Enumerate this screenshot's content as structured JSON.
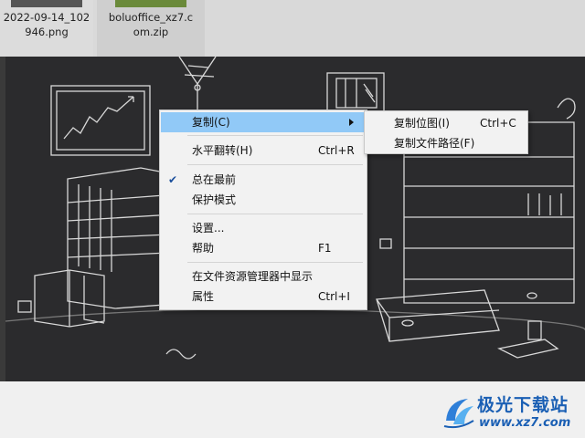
{
  "desktop": {
    "files": [
      {
        "name": "2022-09-14_102\n946.png"
      },
      {
        "name": "boluoffice_xz7.c\nom.zip"
      }
    ]
  },
  "menu": {
    "items": [
      {
        "label": "复制(C)",
        "shortcut": "",
        "highlighted": true,
        "submenu": true
      },
      {
        "label": "水平翻转(H)",
        "shortcut": "Ctrl+R"
      },
      {
        "label": "总在最前",
        "shortcut": "",
        "checked": true
      },
      {
        "label": "保护模式",
        "shortcut": ""
      },
      {
        "label": "设置...",
        "shortcut": ""
      },
      {
        "label": "帮助",
        "shortcut": "F1"
      },
      {
        "label": "在文件资源管理器中显示",
        "shortcut": ""
      },
      {
        "label": "属性",
        "shortcut": "Ctrl+I"
      }
    ],
    "check_glyph": "✔"
  },
  "submenu": {
    "items": [
      {
        "label": "复制位图(I)",
        "shortcut": "Ctrl+C"
      },
      {
        "label": "复制文件路径(F)",
        "shortcut": ""
      }
    ]
  },
  "watermark": {
    "brand": "极光下载站",
    "url": "www.xz7.com"
  },
  "colors": {
    "highlight": "#91c9f7",
    "menu_bg": "#f2f2f2",
    "viewer_bg": "#2b2b2d",
    "brand": "#1a5fb4"
  }
}
